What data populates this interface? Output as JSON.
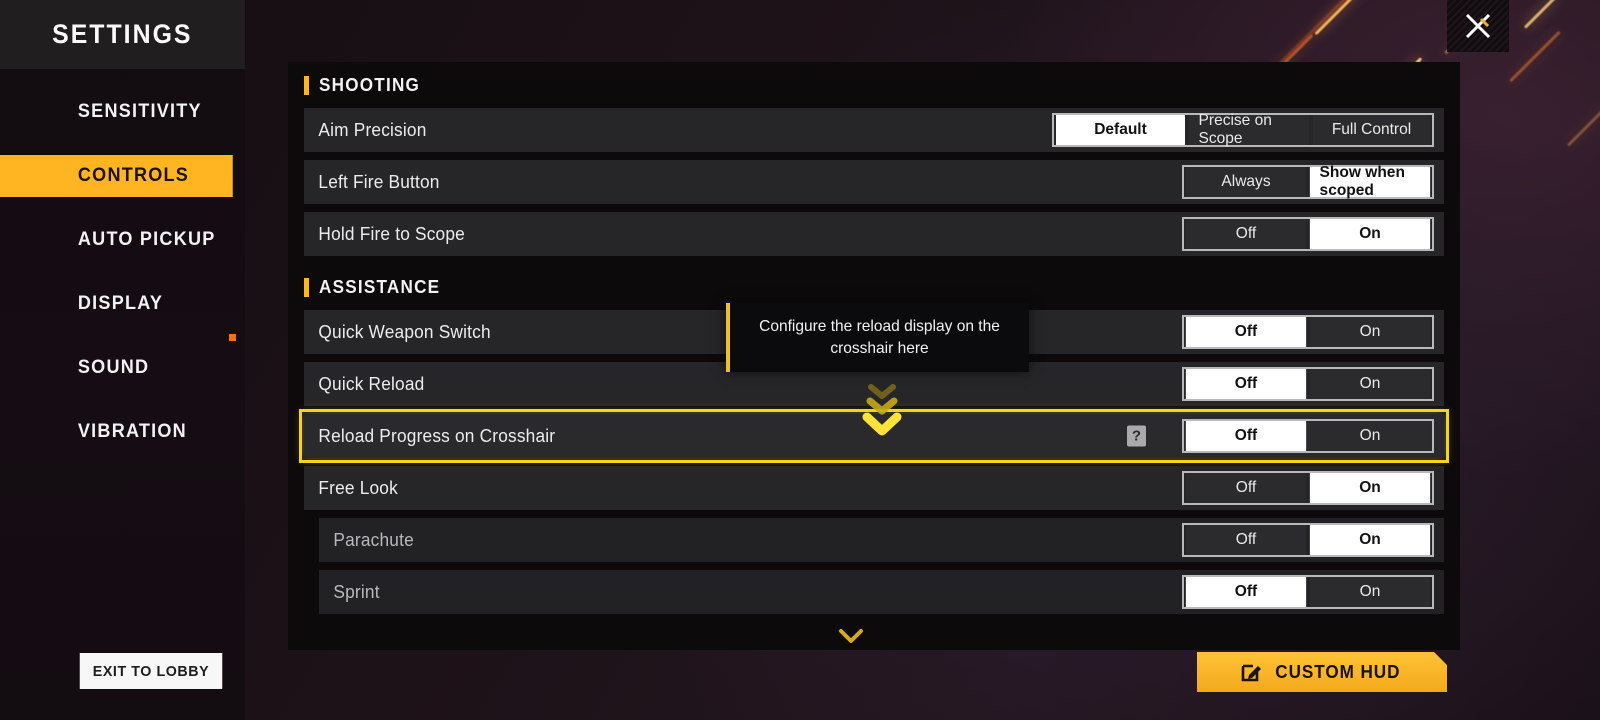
{
  "sidebar": {
    "title": "SETTINGS",
    "items": [
      {
        "label": "SENSITIVITY",
        "active": false
      },
      {
        "label": "CONTROLS",
        "active": true
      },
      {
        "label": "AUTO PICKUP",
        "active": false
      },
      {
        "label": "DISPLAY",
        "active": false
      },
      {
        "label": "SOUND",
        "active": false,
        "badge": true
      },
      {
        "label": "VIBRATION",
        "active": false
      }
    ],
    "exit_label": "EXIT TO LOBBY"
  },
  "header": {
    "close_icon": "close-icon"
  },
  "sections": [
    {
      "title": "SHOOTING",
      "rows": [
        {
          "label": "Aim Precision",
          "sub": false,
          "highlight": false,
          "help": false,
          "seg_type": "aim",
          "options": [
            "Default",
            "Precise on Scope",
            "Full Control"
          ],
          "selected": "Default"
        },
        {
          "label": "Left Fire Button",
          "sub": false,
          "highlight": false,
          "help": false,
          "seg_type": "fire",
          "options": [
            "Always",
            "Show when scoped"
          ],
          "selected": "Show when scoped"
        },
        {
          "label": "Hold Fire to Scope",
          "sub": false,
          "highlight": false,
          "help": false,
          "seg_type": "onoff",
          "options": [
            "Off",
            "On"
          ],
          "selected": "On"
        }
      ]
    },
    {
      "title": "ASSISTANCE",
      "rows": [
        {
          "label": "Quick Weapon Switch",
          "sub": false,
          "highlight": false,
          "help": false,
          "seg_type": "onoff",
          "options": [
            "Off",
            "On"
          ],
          "selected": "Off"
        },
        {
          "label": "Quick Reload",
          "sub": false,
          "highlight": false,
          "help": false,
          "seg_type": "onoff",
          "options": [
            "Off",
            "On"
          ],
          "selected": "Off"
        },
        {
          "label": "Reload Progress on Crosshair",
          "sub": false,
          "highlight": true,
          "help": true,
          "help_icon": "question-mark-icon",
          "seg_type": "onoff",
          "options": [
            "Off",
            "On"
          ],
          "selected": "Off"
        },
        {
          "label": "Free Look",
          "sub": false,
          "highlight": false,
          "help": false,
          "seg_type": "onoff",
          "options": [
            "Off",
            "On"
          ],
          "selected": "On"
        },
        {
          "label": "Parachute",
          "sub": true,
          "highlight": false,
          "help": false,
          "seg_type": "onoff",
          "options": [
            "Off",
            "On"
          ],
          "selected": "On"
        },
        {
          "label": "Sprint",
          "sub": true,
          "highlight": false,
          "help": false,
          "seg_type": "onoff",
          "options": [
            "Off",
            "On"
          ],
          "selected": "Off"
        }
      ]
    }
  ],
  "tooltip": {
    "text": "Configure the reload display on the crosshair here",
    "pointer_icon": "chevrons-down-icon"
  },
  "scroll_indicator": {
    "icon": "chevron-down-icon"
  },
  "custom_hud": {
    "label": "CUSTOM HUD",
    "icon": "edit-pencil-icon"
  },
  "colors": {
    "accent": "#ffb522",
    "highlight": "#f5d515",
    "panel_bg": "#0d0a0c",
    "row_bg": "#262628",
    "selected_bg": "#ffffff"
  }
}
